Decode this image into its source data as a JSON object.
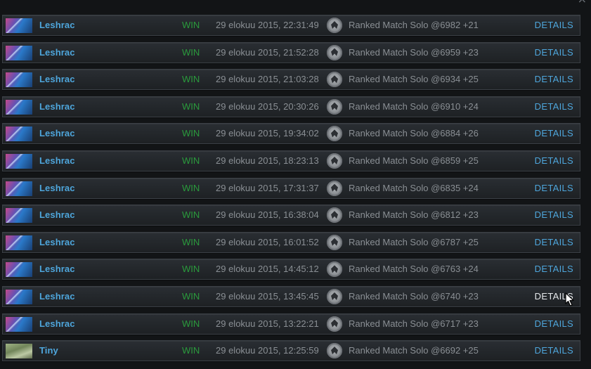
{
  "window": {
    "close_glyph": "×"
  },
  "matches": [
    {
      "hero": "Leshrac",
      "hero_icon": "leshrac",
      "result": "WIN",
      "datetime": "29 elokuu 2015, 22:31:49",
      "match": "Ranked Match Solo @6982 +21",
      "details": "DETAILS"
    },
    {
      "hero": "Leshrac",
      "hero_icon": "leshrac",
      "result": "WIN",
      "datetime": "29 elokuu 2015, 21:52:28",
      "match": "Ranked Match Solo @6959 +23",
      "details": "DETAILS"
    },
    {
      "hero": "Leshrac",
      "hero_icon": "leshrac",
      "result": "WIN",
      "datetime": "29 elokuu 2015, 21:03:28",
      "match": "Ranked Match Solo @6934 +25",
      "details": "DETAILS"
    },
    {
      "hero": "Leshrac",
      "hero_icon": "leshrac",
      "result": "WIN",
      "datetime": "29 elokuu 2015, 20:30:26",
      "match": "Ranked Match Solo @6910 +24",
      "details": "DETAILS"
    },
    {
      "hero": "Leshrac",
      "hero_icon": "leshrac",
      "result": "WIN",
      "datetime": "29 elokuu 2015, 19:34:02",
      "match": "Ranked Match Solo @6884 +26",
      "details": "DETAILS"
    },
    {
      "hero": "Leshrac",
      "hero_icon": "leshrac",
      "result": "WIN",
      "datetime": "29 elokuu 2015, 18:23:13",
      "match": "Ranked Match Solo @6859 +25",
      "details": "DETAILS"
    },
    {
      "hero": "Leshrac",
      "hero_icon": "leshrac",
      "result": "WIN",
      "datetime": "29 elokuu 2015, 17:31:37",
      "match": "Ranked Match Solo @6835 +24",
      "details": "DETAILS"
    },
    {
      "hero": "Leshrac",
      "hero_icon": "leshrac",
      "result": "WIN",
      "datetime": "29 elokuu 2015, 16:38:04",
      "match": "Ranked Match Solo @6812 +23",
      "details": "DETAILS"
    },
    {
      "hero": "Leshrac",
      "hero_icon": "leshrac",
      "result": "WIN",
      "datetime": "29 elokuu 2015, 16:01:52",
      "match": "Ranked Match Solo @6787 +25",
      "details": "DETAILS"
    },
    {
      "hero": "Leshrac",
      "hero_icon": "leshrac",
      "result": "WIN",
      "datetime": "29 elokuu 2015, 14:45:12",
      "match": "Ranked Match Solo @6763 +24",
      "details": "DETAILS"
    },
    {
      "hero": "Leshrac",
      "hero_icon": "leshrac",
      "result": "WIN",
      "datetime": "29 elokuu 2015, 13:45:45",
      "match": "Ranked Match Solo @6740 +23",
      "details": "DETAILS",
      "hovered": true
    },
    {
      "hero": "Leshrac",
      "hero_icon": "leshrac",
      "result": "WIN",
      "datetime": "29 elokuu 2015, 13:22:21",
      "match": "Ranked Match Solo @6717 +23",
      "details": "DETAILS"
    },
    {
      "hero": "Tiny",
      "hero_icon": "tiny",
      "result": "WIN",
      "datetime": "29 elokuu 2015, 12:25:59",
      "match": "Ranked Match Solo @6692 +25",
      "details": "DETAILS"
    }
  ],
  "colors": {
    "hero_name": "#4ea6dc",
    "win": "#2a9a3c",
    "muted_text": "#8a8f94",
    "details_link": "#4ea6dc",
    "details_hover": "#e6e9ec"
  }
}
